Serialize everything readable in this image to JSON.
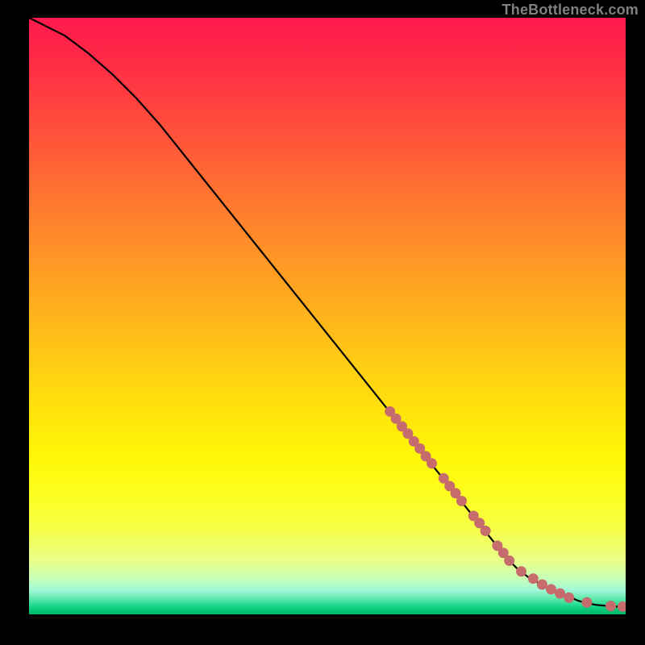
{
  "attribution": "TheBottleneck.com",
  "colors": {
    "background": "#000000",
    "curve": "#000000",
    "marker": "#c76c6c",
    "attribution_text": "#808080"
  },
  "chart_data": {
    "type": "line",
    "title": "",
    "xlabel": "",
    "ylabel": "",
    "xlim": [
      0,
      100
    ],
    "ylim": [
      0,
      100
    ],
    "grid": false,
    "legend": null,
    "annotations": [],
    "series": [
      {
        "name": "curve",
        "style": "line",
        "color": "#000000",
        "x": [
          0,
          2,
          4,
          6,
          8,
          10,
          14,
          18,
          22,
          26,
          30,
          34,
          38,
          42,
          46,
          50,
          54,
          58,
          62,
          66,
          70,
          74,
          78,
          80,
          82,
          84,
          86,
          88,
          90,
          92,
          93,
          95,
          97,
          100
        ],
        "y": [
          100,
          99,
          98,
          97,
          95.5,
          94,
          90.5,
          86.5,
          82,
          77,
          72,
          67,
          62,
          57,
          52,
          47,
          42,
          37,
          32,
          27,
          22,
          17,
          12,
          9.5,
          7.5,
          6,
          5,
          4,
          3.2,
          2.3,
          2,
          1.6,
          1.4,
          1.2
        ]
      },
      {
        "name": "markers",
        "style": "scatter",
        "color": "#c76c6c",
        "x": [
          60.5,
          61.5,
          62.5,
          63.5,
          64.5,
          65.5,
          66.5,
          67.5,
          69.5,
          70.5,
          71.5,
          72.5,
          74.5,
          75.5,
          76.5,
          78.5,
          79.5,
          80.5,
          82.5,
          84.5,
          86,
          87.5,
          89,
          90.5,
          93.5,
          97.5,
          99.5
        ],
        "y": [
          34,
          32.8,
          31.5,
          30.3,
          29,
          27.8,
          26.5,
          25.3,
          22.8,
          21.5,
          20.3,
          19,
          16.5,
          15.3,
          14,
          11.5,
          10.3,
          9,
          7.2,
          6,
          5,
          4.2,
          3.5,
          2.8,
          2,
          1.4,
          1.3
        ]
      }
    ]
  }
}
